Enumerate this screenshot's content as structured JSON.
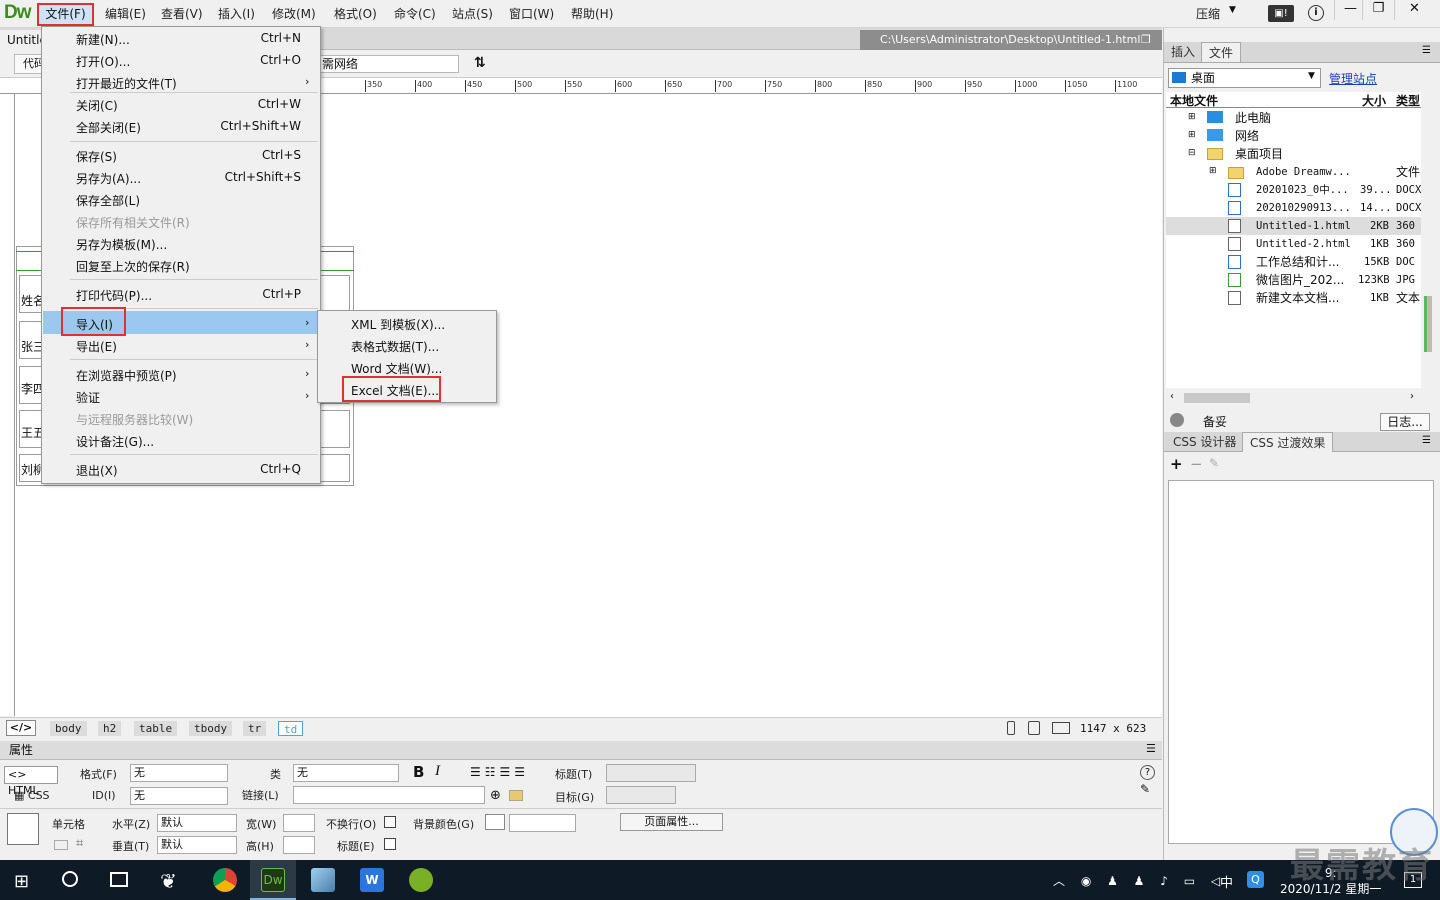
{
  "app": {
    "logo": "Dw",
    "menus": [
      "文件(F)",
      "编辑(E)",
      "查看(V)",
      "插入(I)",
      "修改(M)",
      "格式(O)",
      "命令(C)",
      "站点(S)",
      "窗口(W)",
      "帮助(H)"
    ],
    "compress": "压缩"
  },
  "document": {
    "tab": "Untitle",
    "path": "C:\\Users\\Administrator\\Desktop\\Untitled-1.html",
    "view_button": "代码",
    "title_value": "需网络"
  },
  "ruler": [
    "350",
    "400",
    "450",
    "500",
    "550",
    "600",
    "650",
    "700",
    "750",
    "800",
    "850",
    "900",
    "950",
    "1000",
    "1050",
    "1100"
  ],
  "table_rows": [
    "姓名",
    "张三",
    "李四",
    "王五",
    "刘柳"
  ],
  "file_menu": [
    {
      "label": "新建(N)...",
      "shortcut": "Ctrl+N"
    },
    {
      "label": "打开(O)...",
      "shortcut": "Ctrl+O"
    },
    {
      "label": "打开最近的文件(T)",
      "shortcut": ""
    },
    {
      "label": "关闭(C)",
      "shortcut": "Ctrl+W"
    },
    {
      "label": "全部关闭(E)",
      "shortcut": "Ctrl+Shift+W"
    },
    {
      "label": "保存(S)",
      "shortcut": "Ctrl+S"
    },
    {
      "label": "另存为(A)...",
      "shortcut": "Ctrl+Shift+S"
    },
    {
      "label": "保存全部(L)",
      "shortcut": ""
    },
    {
      "label": "保存所有相关文件(R)",
      "shortcut": ""
    },
    {
      "label": "另存为模板(M)...",
      "shortcut": ""
    },
    {
      "label": "回复至上次的保存(R)",
      "shortcut": ""
    },
    {
      "label": "打印代码(P)...",
      "shortcut": "Ctrl+P"
    },
    {
      "label": "导入(I)",
      "shortcut": ""
    },
    {
      "label": "导出(E)",
      "shortcut": ""
    },
    {
      "label": "在浏览器中预览(P)",
      "shortcut": ""
    },
    {
      "label": "验证",
      "shortcut": ""
    },
    {
      "label": "与远程服务器比较(W)",
      "shortcut": ""
    },
    {
      "label": "设计备注(G)...",
      "shortcut": ""
    },
    {
      "label": "退出(X)",
      "shortcut": "Ctrl+Q"
    }
  ],
  "import_submenu": [
    "XML 到模板(X)...",
    "表格式数据(T)...",
    "Word 文档(W)...",
    "Excel 文档(E)..."
  ],
  "tagbar": {
    "tags": [
      "body",
      "h2",
      "table",
      "tbody",
      "tr",
      "td"
    ],
    "size": "1147 x 623"
  },
  "properties": {
    "title": "属性",
    "html": "HTML",
    "css": "CSS",
    "format_label": "格式(F)",
    "format_value": "无",
    "class_label": "类",
    "class_value": "无",
    "id_label": "ID(I)",
    "id_value": "无",
    "link_label": "链接(L)",
    "title_label": "标题(T)",
    "target_label": "目标(G)",
    "cell_label": "单元格",
    "h_label": "水平(Z)",
    "h_value": "默认",
    "v_label": "垂直(T)",
    "v_value": "默认",
    "w_label": "宽(W)",
    "h2_label": "高(H)",
    "nowrap_label": "不换行(O)",
    "header_label": "标题(E)",
    "bg_label": "背景颜色(G)",
    "page_props": "页面属性..."
  },
  "right_panel": {
    "tabs": [
      "插入",
      "文件"
    ],
    "site": "桌面",
    "manage": "管理站点",
    "columns": [
      "本地文件",
      "大小",
      "类型"
    ],
    "tree": [
      {
        "name": "此电脑",
        "size": "",
        "type": ""
      },
      {
        "name": "网络",
        "size": "",
        "type": ""
      },
      {
        "name": "桌面项目",
        "size": "",
        "type": ""
      },
      {
        "name": "Adobe Dreamw...",
        "size": "",
        "type": "文件"
      },
      {
        "name": "20201023_0中...",
        "size": "39...",
        "type": "DOCX"
      },
      {
        "name": "202010290913...",
        "size": "14...",
        "type": "DOCX"
      },
      {
        "name": "Untitled-1.html",
        "size": "2KB",
        "type": "360"
      },
      {
        "name": "Untitled-2.html",
        "size": "1KB",
        "type": "360"
      },
      {
        "name": "工作总结和计...",
        "size": "15KB",
        "type": "DOC"
      },
      {
        "name": "微信图片_202...",
        "size": "123KB",
        "type": "JPG"
      },
      {
        "name": "新建文本文档...",
        "size": "1KB",
        "type": "文本"
      }
    ],
    "backup": "备妥",
    "log": "日志...",
    "css_tabs": [
      "CSS 设计器",
      "CSS 过渡效果"
    ]
  },
  "taskbar": {
    "ime": "中",
    "clock_time": "9:",
    "clock_date": "2020/11/2 星期一",
    "notif": "1"
  },
  "watermark": "最需教育"
}
